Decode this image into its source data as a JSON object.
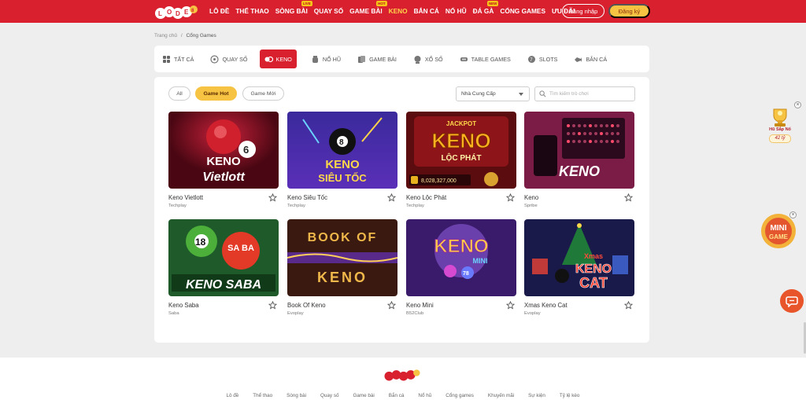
{
  "header": {
    "logo_text": "LODE88",
    "nav": [
      {
        "label": "LÔ ĐỀ",
        "badge": ""
      },
      {
        "label": "THỂ THAO",
        "badge": ""
      },
      {
        "label": "SÒNG BÀI",
        "badge": "LIVE"
      },
      {
        "label": "QUAY SỐ",
        "badge": ""
      },
      {
        "label": "GAME BÀI",
        "badge": "HOT"
      },
      {
        "label": "KENO",
        "badge": ""
      },
      {
        "label": "BẮN CÁ",
        "badge": ""
      },
      {
        "label": "NỔ HŨ",
        "badge": ""
      },
      {
        "label": "ĐÁ GÀ",
        "badge": "NEW"
      },
      {
        "label": "CỔNG GAMES",
        "badge": ""
      },
      {
        "label": "ƯU ĐÃI",
        "badge": ""
      }
    ],
    "active_nav": "KENO",
    "login_label": "Đăng nhập",
    "register_label": "Đăng ký"
  },
  "breadcrumb": {
    "home": "Trang chủ",
    "separator": "/",
    "current": "Cổng Games"
  },
  "categories": [
    {
      "label": "TẤT CẢ",
      "icon": "grid-icon"
    },
    {
      "label": "QUAY SỐ",
      "icon": "lottery-icon"
    },
    {
      "label": "KENO",
      "icon": "keno-icon",
      "active": true
    },
    {
      "label": "NỔ HŨ",
      "icon": "jar-icon"
    },
    {
      "label": "GAME BÀI",
      "icon": "cards-icon"
    },
    {
      "label": "XỔ SỐ",
      "icon": "lotto-ball-icon"
    },
    {
      "label": "TABLE GAMES",
      "icon": "table-icon"
    },
    {
      "label": "SLOTS",
      "icon": "slots-icon"
    },
    {
      "label": "BẮN CÁ",
      "icon": "fish-icon"
    }
  ],
  "filters": {
    "all": "All",
    "hot": "Game Hot",
    "new": "Game Mới",
    "provider_select": "Nhà Cung Cấp",
    "search_placeholder": "Tìm kiếm trò chơi"
  },
  "games": [
    {
      "name": "Keno Vietlott",
      "provider": "Techplay",
      "art_line1": "KENO",
      "art_line2": "Vietlott",
      "art_extra": "6"
    },
    {
      "name": "Keno Siêu Tốc",
      "provider": "Techplay",
      "art_line1": "KENO",
      "art_line2": "SIÊU TỐC",
      "art_extra": "8"
    },
    {
      "name": "Keno Lộc Phát",
      "provider": "Techplay",
      "art_line1": "KENO",
      "art_line2": "LỘC PHÁT",
      "art_extra": "8,028,327,000",
      "art_top": "JACKPOT"
    },
    {
      "name": "Keno",
      "provider": "Spribe",
      "art_line1": "KENO",
      "art_line2": "",
      "art_extra": ""
    },
    {
      "name": "Keno Saba",
      "provider": "Saba",
      "art_line1": "KENO SABA",
      "art_line2": "SA BA",
      "art_extra": "18"
    },
    {
      "name": "Book Of Keno",
      "provider": "Evoplay",
      "art_line1": "BOOK OF",
      "art_line2": "KENO",
      "art_extra": ""
    },
    {
      "name": "Keno Mini",
      "provider": "B52Club",
      "art_line1": "KENO",
      "art_line2": "MINI",
      "art_extra": "78"
    },
    {
      "name": "Xmas Keno Cat",
      "provider": "Evoplay",
      "art_line1": "Xmas",
      "art_line2": "KENO",
      "art_extra": "CAT"
    }
  ],
  "floats": {
    "jackpot_label": "Hũ Sắp Nổ",
    "jackpot_value": "42 tỷ",
    "mini_game_line1": "MINI",
    "mini_game_line2": "GAME"
  },
  "footer": {
    "logo_text": "LODE88",
    "links": [
      "Lô đề",
      "Thể thao",
      "Sòng bài",
      "Quay số",
      "Game bài",
      "Bắn cá",
      "Nổ hũ",
      "Cổng games",
      "Khuyến mãi",
      "Sự kiện",
      "Tỷ lệ kèo"
    ]
  },
  "colors": {
    "brand_red": "#d8202f",
    "accent_yellow": "#f6c343"
  }
}
